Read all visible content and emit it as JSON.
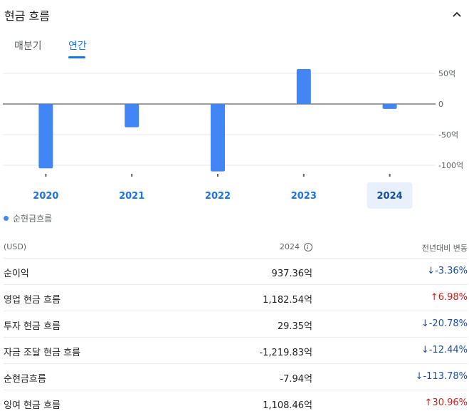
{
  "header": {
    "title": "현금 흐름"
  },
  "tabs": [
    {
      "label": "매분기",
      "active": false
    },
    {
      "label": "연간",
      "active": true
    }
  ],
  "chart_data": {
    "type": "bar",
    "categories": [
      "2020",
      "2021",
      "2022",
      "2023",
      "2024"
    ],
    "selected_category": "2024",
    "series": [
      {
        "name": "순현금흐름",
        "values": [
          -105,
          -38,
          -110,
          57,
          -7.94
        ],
        "color": "#4285f4"
      }
    ],
    "y_ticks": [
      50,
      0,
      -50,
      -100
    ],
    "y_tick_labels": [
      "50억",
      "0",
      "-50억",
      "-100억"
    ],
    "ylim": [
      -115,
      62
    ],
    "grid": true,
    "legend_position": "bottom-left"
  },
  "table": {
    "headers": {
      "label": "(USD)",
      "year": "2024",
      "change": "전년대비 변동"
    },
    "rows": [
      {
        "label": "순이익",
        "value": "937.36억",
        "change": "-3.36%",
        "direction": "down"
      },
      {
        "label": "영업 현금 흐름",
        "value": "1,182.54억",
        "change": "6.98%",
        "direction": "up"
      },
      {
        "label": "투자 현금 흐름",
        "value": "29.35억",
        "change": "-20.78%",
        "direction": "down"
      },
      {
        "label": "자금 조달 현금 흐름",
        "value": "-1,219.83억",
        "change": "-12.44%",
        "direction": "down"
      },
      {
        "label": "순현금흐름",
        "value": "-7.94억",
        "change": "-113.78%",
        "direction": "down"
      },
      {
        "label": "잉여 현금 흐름",
        "value": "1,108.46억",
        "change": "30.96%",
        "direction": "up"
      }
    ]
  },
  "colors": {
    "accent": "#1a73e8",
    "bar": "#4285f4",
    "down": "#1a4fa0",
    "up": "#c5221f",
    "selected_bg": "#e8f0fe"
  },
  "icons": {
    "collapse": "chevron-up-icon",
    "info": "info-icon",
    "arrow_down": "arrow-down-icon",
    "arrow_up": "arrow-up-icon"
  }
}
